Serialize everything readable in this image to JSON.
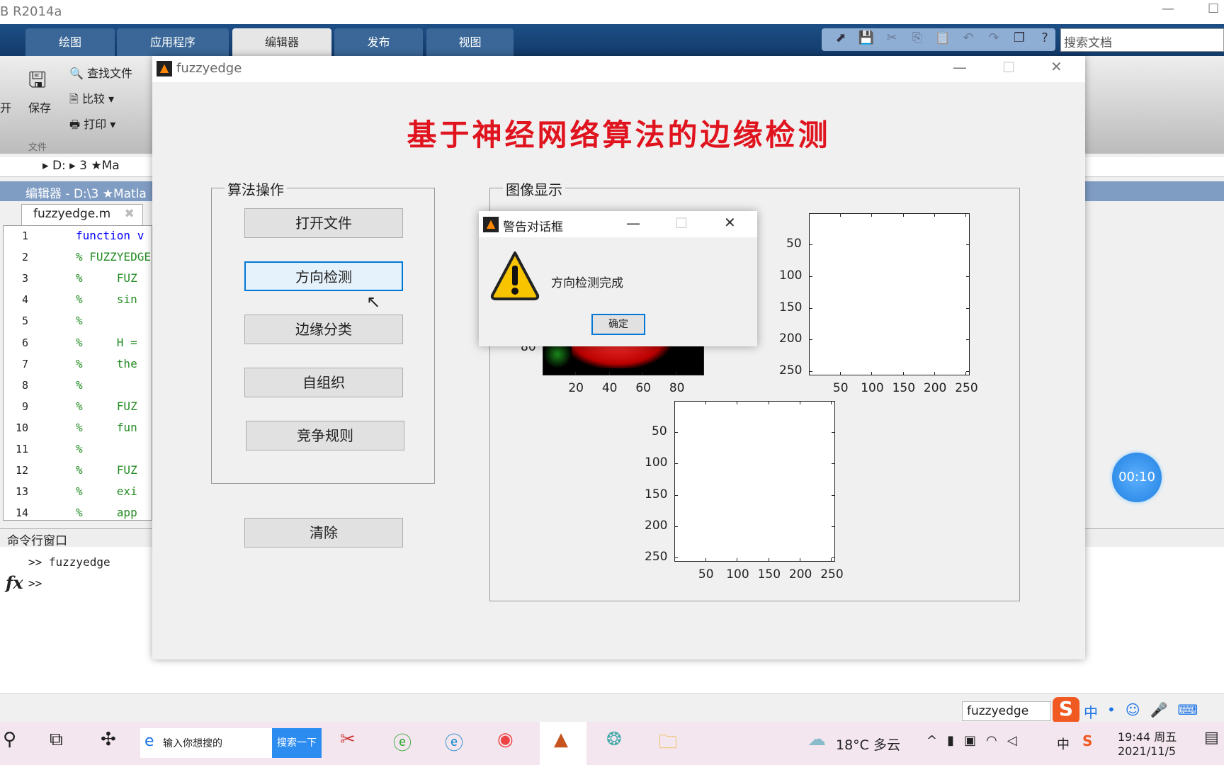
{
  "app": {
    "title": "B R2014a"
  },
  "tabs": [
    {
      "label": "绘图"
    },
    {
      "label": "应用程序"
    },
    {
      "label": "编辑器",
      "active": true
    },
    {
      "label": "发布"
    },
    {
      "label": "视图"
    }
  ],
  "search_docs": {
    "placeholder": "搜索文档"
  },
  "ribbon": {
    "open": "开",
    "save": "保存",
    "find_files": "查找文件",
    "compare": "比较",
    "print": "打印",
    "group_file": "文件"
  },
  "path": {
    "drive": "D:",
    "folder": "3 ★Ma"
  },
  "editor": {
    "title": "编辑器 - D:\\3 ★Matla",
    "tab": "fuzzyedge.m",
    "lines": [
      {
        "n": "1",
        "code": "function v",
        "kw": true
      },
      {
        "n": "2",
        "code": "% FUZZYEDGE"
      },
      {
        "n": "3",
        "code": "%     FUZ"
      },
      {
        "n": "4",
        "code": "%     sin"
      },
      {
        "n": "5",
        "code": "%"
      },
      {
        "n": "6",
        "code": "%     H ="
      },
      {
        "n": "7",
        "code": "%     the"
      },
      {
        "n": "8",
        "code": "%"
      },
      {
        "n": "9",
        "code": "%     FUZ"
      },
      {
        "n": "10",
        "code": "%     fun"
      },
      {
        "n": "11",
        "code": "%"
      },
      {
        "n": "12",
        "code": "%     FUZ"
      },
      {
        "n": "13",
        "code": "%     exi"
      },
      {
        "n": "14",
        "code": "%     app"
      }
    ]
  },
  "command_window": {
    "title": "命令行窗口",
    "lines": [
      ">> fuzzyedge",
      ">>"
    ],
    "fx": "fx"
  },
  "figure": {
    "title": "fuzzyedge",
    "heading": "基于神经网络算法的边缘检测",
    "ops_panel": "算法操作",
    "buttons": [
      "打开文件",
      "方向检测",
      "边缘分类",
      "自组织",
      "竞争规则"
    ],
    "clear": "清除",
    "display_panel": "图像显示",
    "axes": {
      "image_xticks": [
        "20",
        "40",
        "60",
        "80"
      ],
      "image_ytick": "80",
      "xticks": [
        "50",
        "100",
        "150",
        "200",
        "250"
      ],
      "yticks": [
        "50",
        "100",
        "150",
        "200",
        "250"
      ]
    }
  },
  "dialog": {
    "title": "警告对话框",
    "message": "方向检测完成",
    "ok": "确定"
  },
  "timer": "00:10",
  "ime": {
    "text": "fuzzyedge",
    "mode": "中"
  },
  "taskbar": {
    "search_placeholder": "输入你想搜的",
    "search_button": "搜索一下",
    "weather": "18°C 多云",
    "time": "19:44 周五",
    "date": "2021/11/5",
    "ime": "中"
  }
}
